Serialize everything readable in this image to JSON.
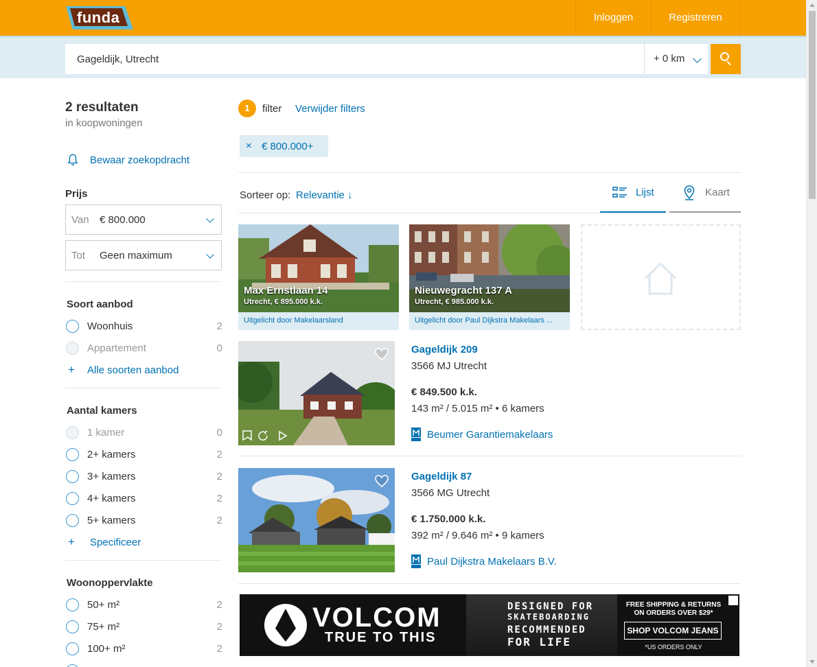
{
  "header": {
    "logo_text": "funda",
    "login_label": "Inloggen",
    "register_label": "Registreren",
    "brand_color": "#f7a100"
  },
  "search": {
    "query": "Gageldijk, Utrecht",
    "radius": "+ 0 km"
  },
  "sidebar": {
    "result_count": "2 resultaten",
    "result_scope": "in koopwoningen",
    "save_search": "Bewaar zoekopdracht",
    "price": {
      "title": "Prijs",
      "from_prefix": "Van",
      "from_value": "€ 800.000",
      "to_prefix": "Tot",
      "to_value": "Geen maximum"
    },
    "offer_type": {
      "title": "Soort aanbod",
      "options": [
        {
          "label": "Woonhuis",
          "count": "2"
        },
        {
          "label": "Appartement",
          "count": "0"
        }
      ],
      "more": "Alle soorten aanbod"
    },
    "rooms": {
      "title": "Aantal kamers",
      "options": [
        {
          "label": "1 kamer",
          "count": "0"
        },
        {
          "label": "2+ kamers",
          "count": "2"
        },
        {
          "label": "3+ kamers",
          "count": "2"
        },
        {
          "label": "4+ kamers",
          "count": "2"
        },
        {
          "label": "5+ kamers",
          "count": "2"
        }
      ],
      "more": "Specificeer"
    },
    "living_area": {
      "title": "Woonoppervlakte",
      "options": [
        {
          "label": "50+ m²",
          "count": "2"
        },
        {
          "label": "75+ m²",
          "count": "2"
        },
        {
          "label": "100+ m²",
          "count": "2"
        }
      ]
    }
  },
  "filters": {
    "count": "1",
    "label": "filter",
    "remove_label": "Verwijder filters",
    "active_chip": "€ 800.000+"
  },
  "sort": {
    "label": "Sorteer op:",
    "value": "Relevantie ↓"
  },
  "view_tabs": {
    "list": "Lijst",
    "map": "Kaart"
  },
  "featured": [
    {
      "title": "Max Ernstlaan 14",
      "subtitle": "Utrecht, € 895.000 k.k.",
      "highlighted_by": "Uitgelicht door Makelaarsland"
    },
    {
      "title": "Nieuwegracht 137 A",
      "subtitle": "Utrecht, € 985.000 k.k.",
      "highlighted_by": "Uitgelicht door Paul Dijkstra Makelaars ..."
    }
  ],
  "listings": [
    {
      "street": "Gageldijk 209",
      "zip_city": "3566 MJ Utrecht",
      "price": "€ 849.500 k.k.",
      "specs": "143 m² / 5.015 m²  •  6 kamers",
      "agent": "Beumer Garantiemakelaars"
    },
    {
      "street": "Gageldijk 87",
      "zip_city": "3566 MG Utrecht",
      "price": "€ 1.750.000 k.k.",
      "specs": "392 m² / 9.646 m²  •  9 kamers",
      "agent": "Paul Dijkstra Makelaars B.V."
    }
  ],
  "ad": {
    "brand": "VOLCOM",
    "tagline": "TRUE TO THIS",
    "line1": "DESIGNED FOR",
    "line2": "SKATEBOARDING",
    "line3": "RECOMMENDED",
    "line4": "FOR LIFE",
    "shipping": "FREE SHIPPING & RETURNS ON ORDERS OVER $29*",
    "button": "SHOP VOLCOM JEANS",
    "note": "*US ORDERS ONLY"
  }
}
